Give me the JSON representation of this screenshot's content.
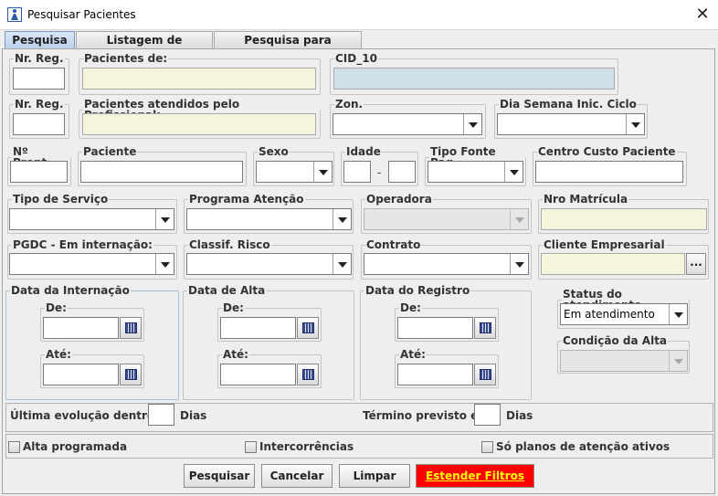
{
  "window": {
    "title": "Pesquisar Pacientes",
    "close_glyph": "✕"
  },
  "tabs": [
    {
      "label": "Pesquisa"
    },
    {
      "label": "Listagem de Pacientes"
    },
    {
      "label": "Pesquisa para Relatórios"
    }
  ],
  "fields": {
    "nr_reg_1": "Nr. Reg.",
    "pacientes_de": "Pacientes de:",
    "cid10": "CID_10",
    "nr_reg_2": "Nr. Reg.",
    "pac_atendidos": "Pacientes atendidos pelo Profissional:",
    "zon": "Zon.",
    "dia_semana": "Dia Semana Inic. Ciclo",
    "n_pront": "Nº Pront...",
    "paciente": "Paciente",
    "sexo": "Sexo",
    "idade": "Idade",
    "idade_sep": "-",
    "tipo_fonte": "Tipo Fonte Pag...",
    "centro_custo": "Centro Custo Paciente",
    "tipo_servico": "Tipo de Serviço",
    "programa_atencao": "Programa Atenção",
    "operadora": "Operadora",
    "nro_matricula": "Nro Matrícula",
    "pgdc": "PGDC - Em internação:",
    "classif_risco": "Classif. Risco",
    "contrato": "Contrato",
    "cliente_empresarial": "Cliente Empresarial",
    "cliente_btn": "..."
  },
  "dates": {
    "internacao": "Data da Internação",
    "alta": "Data de Alta",
    "registro": "Data do Registro",
    "de": "De:",
    "ate": "Até:"
  },
  "status": {
    "label": "Status do atendimento",
    "value": "Em atendimento",
    "condicao_label": "Condição da Alta"
  },
  "evolucao": {
    "ultima_label": "Última evolução dentro de",
    "dias1": "Dias",
    "termino_label": "Término previsto em",
    "dias2": "Dias"
  },
  "checks": {
    "alta": "Alta programada",
    "intercorrencias": "Intercorrências",
    "planos": "Só planos de atenção ativos"
  },
  "buttons": {
    "pesquisar": "Pesquisar",
    "cancelar": "Cancelar",
    "limpar": "Limpar",
    "estender": "Estender Filtros"
  },
  "colors": {
    "accent_red": "#ff0000",
    "accent_yellow": "#ffff00"
  }
}
